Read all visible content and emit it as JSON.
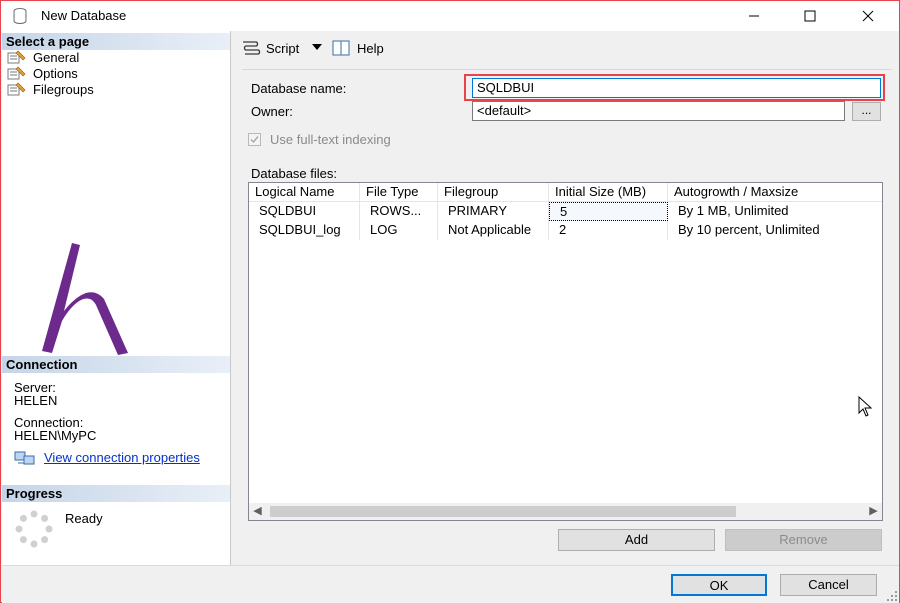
{
  "window": {
    "title": "New Database",
    "icon": "database-icon",
    "controls": [
      "minimize-icon",
      "maximize-icon",
      "close-icon"
    ]
  },
  "left_pane": {
    "select_page_header": "Select a page",
    "pages": [
      {
        "label": "General",
        "icon": "page-wrench-icon"
      },
      {
        "label": "Options",
        "icon": "page-wrench-icon"
      },
      {
        "label": "Filegroups",
        "icon": "page-wrench-icon"
      }
    ],
    "connection": {
      "header": "Connection",
      "server_label": "Server:",
      "server_value": "HELEN",
      "connection_label": "Connection:",
      "connection_value": "HELEN\\MyPC",
      "link": "View connection properties",
      "link_icon": "connection-properties-icon"
    },
    "progress": {
      "header": "Progress",
      "status": "Ready",
      "icon": "spinner-icon"
    }
  },
  "toolbar": {
    "script_label": "Script",
    "script_icon": "script-icon",
    "dropdown_icon": "chevron-down-icon",
    "help_label": "Help",
    "help_icon": "help-icon"
  },
  "general": {
    "database_name_label": "Database name:",
    "database_name_value": "SQLDBUI",
    "owner_label": "Owner:",
    "owner_value": "<default>",
    "browse_label": "...",
    "fulltext_label": "Use full-text indexing",
    "fulltext_checked": true,
    "database_files_label": "Database files:"
  },
  "files_grid": {
    "columns": [
      "Logical Name",
      "File Type",
      "Filegroup",
      "Initial Size (MB)",
      "Autogrowth / Maxsize"
    ],
    "rows": [
      [
        "SQLDBUI",
        "ROWS...",
        "PRIMARY",
        "5",
        "By 1 MB, Unlimited"
      ],
      [
        "SQLDBUI_log",
        "LOG",
        "Not Applicable",
        "2",
        "By 10 percent, Unlimited"
      ]
    ]
  },
  "grid_buttons": {
    "add": "Add",
    "remove": "Remove"
  },
  "footer": {
    "ok": "OK",
    "cancel": "Cancel"
  },
  "colors": {
    "highlight": "#e8434d",
    "logo": "#6b2a8c",
    "link": "#0033cc",
    "focus": "#0078d7"
  }
}
